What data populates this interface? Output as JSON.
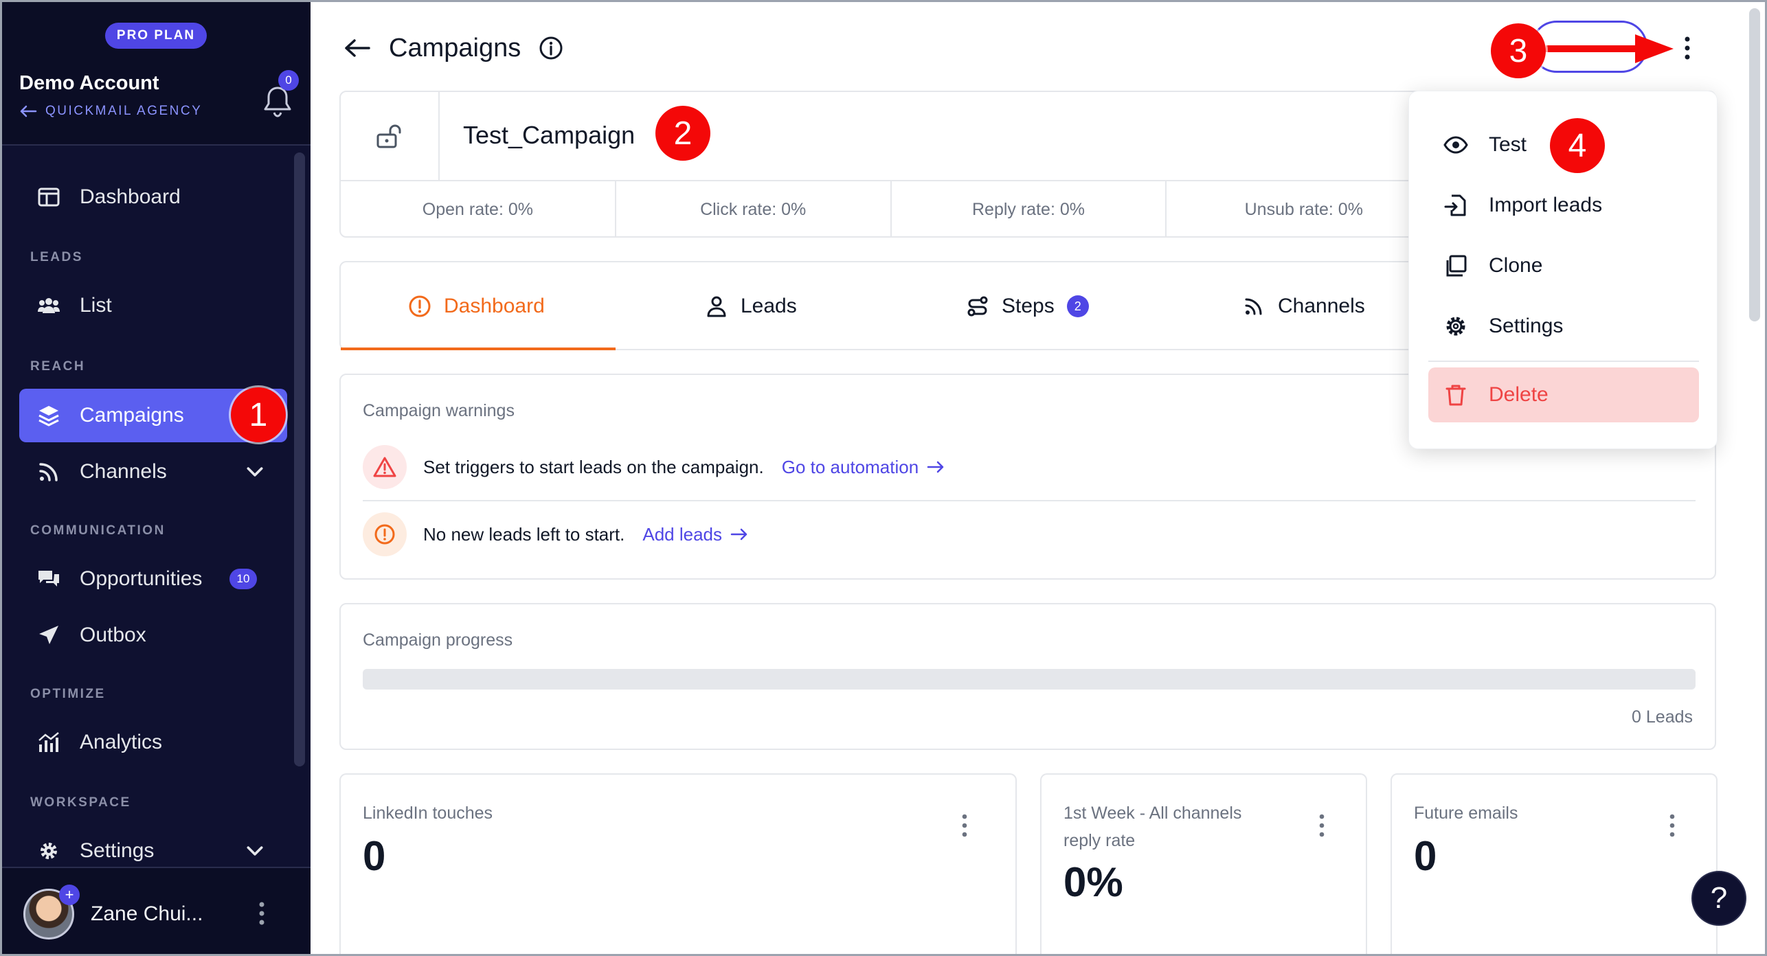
{
  "sidebar": {
    "plan_badge": "PRO PLAN",
    "account_name": "Demo Account",
    "agency": "QUICKMAIL AGENCY",
    "notification_count": "0",
    "items": {
      "dashboard": "Dashboard",
      "leads_section": "LEADS",
      "list": "List",
      "reach_section": "REACH",
      "campaigns": "Campaigns",
      "channels": "Channels",
      "communication_section": "COMMUNICATION",
      "opportunities": "Opportunities",
      "opportunities_count": "10",
      "outbox": "Outbox",
      "optimize_section": "OPTIMIZE",
      "analytics": "Analytics",
      "workspace_section": "WORKSPACE",
      "settings": "Settings"
    },
    "user": {
      "name": "Zane Chui...",
      "plus": "+"
    }
  },
  "header": {
    "title": "Campaigns"
  },
  "campaign": {
    "name": "Test_Campaign",
    "rates": [
      "Open rate: 0%",
      "Click rate: 0%",
      "Reply rate: 0%",
      "Unsub rate: 0%"
    ]
  },
  "tabs": {
    "dashboard": "Dashboard",
    "leads": "Leads",
    "steps": "Steps",
    "steps_count": "2",
    "channels": "Channels"
  },
  "warnings": {
    "title": "Campaign warnings",
    "items": [
      {
        "text": "Set triggers to start leads on the campaign.",
        "link": "Go to automation"
      },
      {
        "text": "No new leads left to start.",
        "link": "Add leads"
      }
    ]
  },
  "progress": {
    "title": "Campaign progress",
    "leads": "0 Leads",
    "fraction": 0
  },
  "stats": [
    {
      "title": "LinkedIn touches",
      "value": "0"
    },
    {
      "title_line1": "1st Week - All channels",
      "title_line2": "reply rate",
      "value": "0%"
    },
    {
      "title": "Future emails",
      "value": "0"
    }
  ],
  "menu": {
    "test": "Test",
    "import_leads": "Import leads",
    "clone": "Clone",
    "settings": "Settings",
    "delete": "Delete"
  },
  "annotations": [
    "1",
    "2",
    "3",
    "4"
  ],
  "help": "?",
  "colors": {
    "sidebar_bg": "#0f1130",
    "accent": "#4f46e5",
    "tab_active": "#f26a1b",
    "danger": "#ef4444",
    "annotation": "#f40808"
  }
}
